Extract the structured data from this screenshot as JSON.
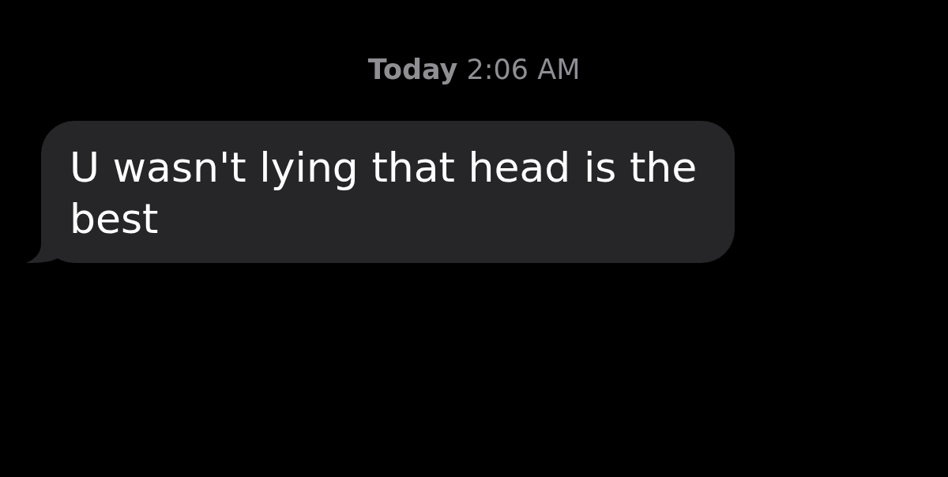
{
  "timestamp": "**Today** 2:06 AM",
  "messages": [
    {
      "from_me": false,
      "text": "U wasn't lying that head is the best"
    }
  ]
}
